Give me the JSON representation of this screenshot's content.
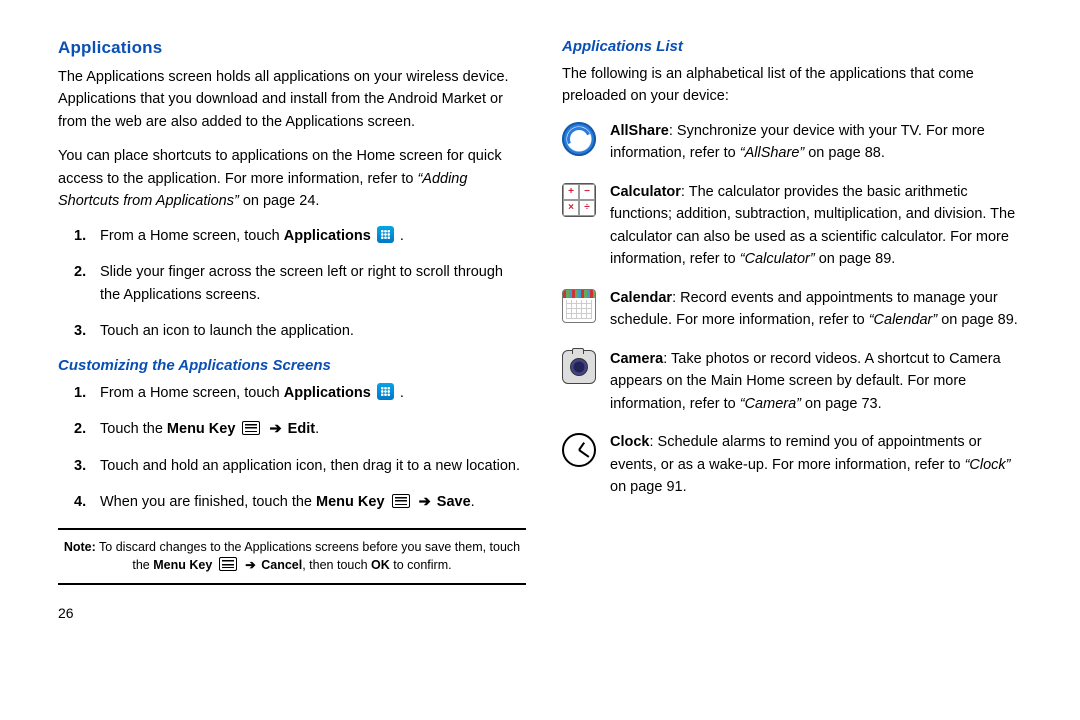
{
  "left": {
    "heading": "Applications",
    "para1": "The Applications screen holds all applications on your wireless device. Applications that you download and install from the Android Market or from the web are also added to the Applications screen.",
    "para2_a": "You can place shortcuts to applications on the Home screen for quick access to the application. For more information, refer to ",
    "para2_ref": "“Adding Shortcuts from Applications”",
    "para2_b": "  on page 24.",
    "steps1": {
      "s1a": "From a Home screen, touch ",
      "s1b": "Applications",
      "s1c": " .",
      "s2": "Slide your finger across the screen left or right to scroll through the Applications screens.",
      "s3": "Touch an icon to launch the application."
    },
    "sub1": "Customizing the Applications Screens",
    "steps2": {
      "s1a": "From a Home screen, touch ",
      "s1b": "Applications",
      "s1c": " .",
      "s2a": "Touch the ",
      "s2b": "Menu Key",
      "s2c": " ",
      "s2d": "Edit",
      "s2e": ".",
      "s3": "Touch and hold an application icon, then drag it to a new location.",
      "s4a": "When you are finished, touch the ",
      "s4b": "Menu Key",
      "s4c": " ",
      "s4d": "Save",
      "s4e": "."
    },
    "note_a": "Note:",
    "note_b": " To discard changes to the Applications screens before you save them, touch the ",
    "note_c": "Menu Key",
    "note_d": " ",
    "note_e": "Cancel",
    "note_f": ", then touch ",
    "note_g": "OK",
    "note_h": " to confirm.",
    "page_num": "26"
  },
  "right": {
    "sub": "Applications List",
    "intro": "The following is an alphabetical list of the applications that come preloaded on your device:",
    "apps": {
      "allshare": {
        "name": "AllShare",
        "text_a": ": Synchronize your device with your TV. For more information, refer to ",
        "ref": "“AllShare”",
        "text_b": "  on page 88."
      },
      "calculator": {
        "name": "Calculator",
        "text_a": ": The calculator provides the basic arithmetic functions; addition, subtraction, multiplication, and division. The calculator can also be used as a scientific calculator. For more information, refer to ",
        "ref": "“Calculator”",
        "text_b": "  on page 89."
      },
      "calendar": {
        "name": "Calendar",
        "text_a": ": Record events and appointments to manage your schedule. For more information, refer to ",
        "ref": "“Calendar”",
        "text_b": "  on page 89."
      },
      "camera": {
        "name": "Camera",
        "text_a": ": Take photos or record videos. A shortcut to Camera appears on the Main Home screen by default. For more information, refer to ",
        "ref": "“Camera”",
        "text_b": "  on page 73."
      },
      "clock": {
        "name": "Clock",
        "text_a": ": Schedule alarms to remind you of appointments or events, or as a wake-up. For more information, refer to ",
        "ref": "“Clock”",
        "text_b": "  on page 91."
      }
    }
  },
  "glyphs": {
    "arrow": "➔"
  }
}
